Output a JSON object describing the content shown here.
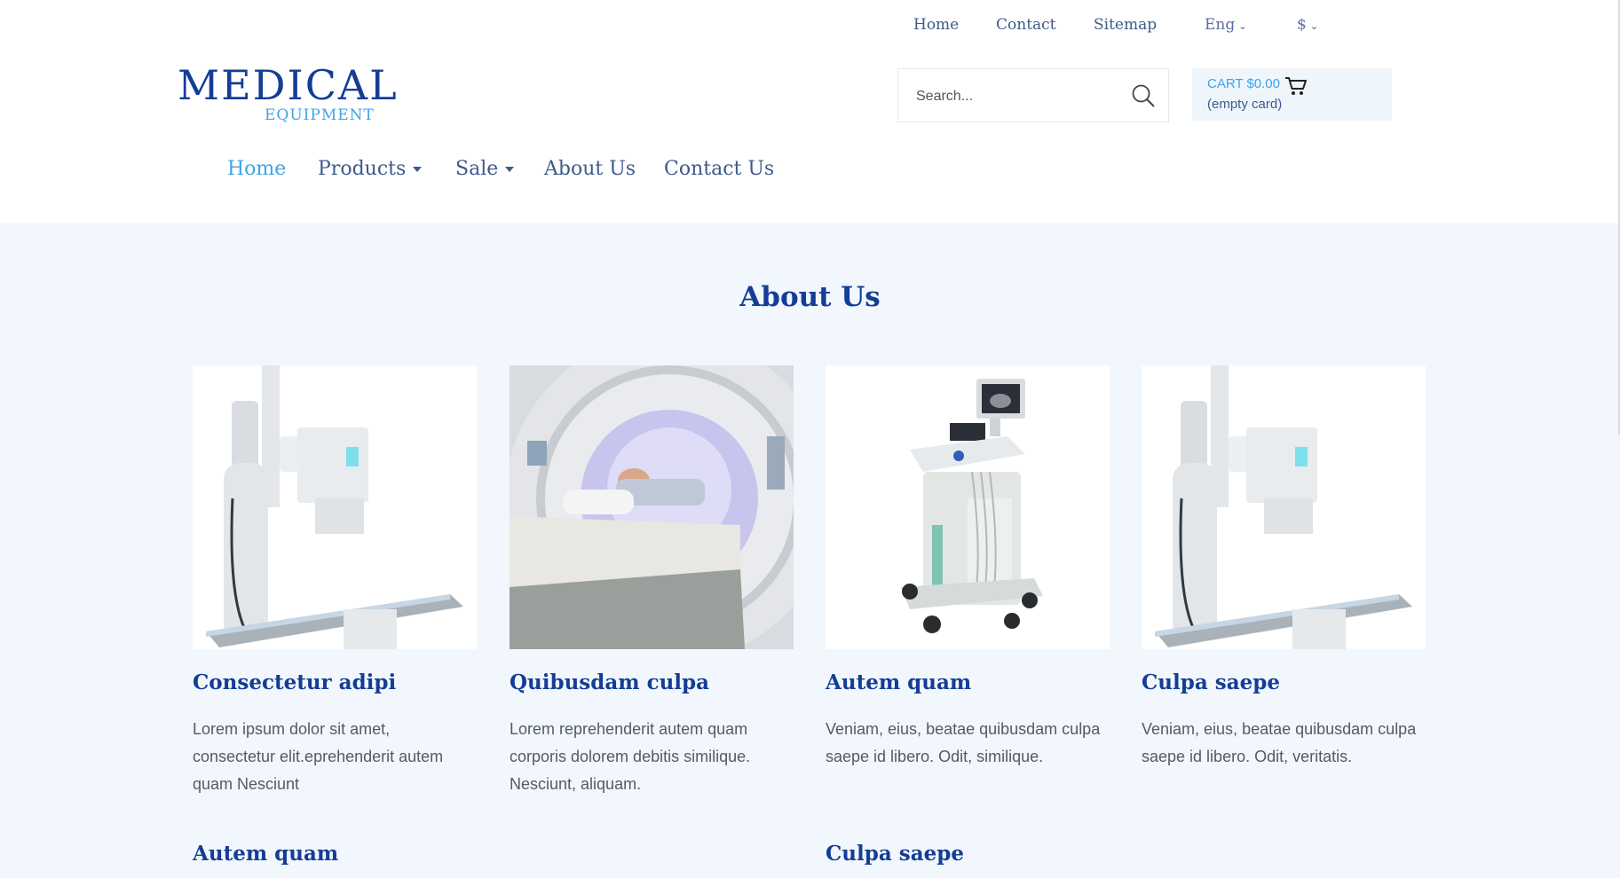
{
  "topnav": {
    "home": "Home",
    "contact": "Contact",
    "sitemap": "Sitemap",
    "language": "Eng",
    "currency": "$"
  },
  "logo": {
    "main": "MEDICAL",
    "sub": "EQUIPMENT"
  },
  "search": {
    "placeholder": "Search..."
  },
  "cart": {
    "label": "CART $0.00",
    "status": "(empty card)"
  },
  "mainnav": {
    "items": [
      {
        "label": "Home",
        "active": true
      },
      {
        "label": "Products",
        "dropdown": true
      },
      {
        "label": "Sale",
        "dropdown": true
      },
      {
        "label": "About Us"
      },
      {
        "label": "Contact Us"
      }
    ]
  },
  "about": {
    "title": "About Us",
    "cards": [
      {
        "image": "x-ray-machine",
        "title": "Consectetur adipi",
        "text": "Lorem ipsum dolor sit amet, consectetur elit.eprehenderit autem quam Nesciunt"
      },
      {
        "image": "mri-scanner",
        "title": "Quibusdam culpa",
        "text": "Lorem reprehenderit autem quam corporis dolorem debitis similique. Nesciunt, aliquam."
      },
      {
        "image": "ultrasound-cart",
        "title": "Autem quam",
        "text": "Veniam, eius, beatae quibusdam culpa saepe id libero. Odit, similique."
      },
      {
        "image": "x-ray-machine",
        "title": "Culpa saepe",
        "text": "Veniam, eius, beatae quibusdam culpa saepe id libero. Odit, veritatis."
      }
    ],
    "row2_titles": [
      "Autem quam",
      "Culpa saepe"
    ]
  },
  "colors": {
    "brand_dark": "#143d96",
    "accent": "#3fa3e6",
    "nav_text": "#3d5a8a",
    "section_bg": "#f1f7fc"
  }
}
